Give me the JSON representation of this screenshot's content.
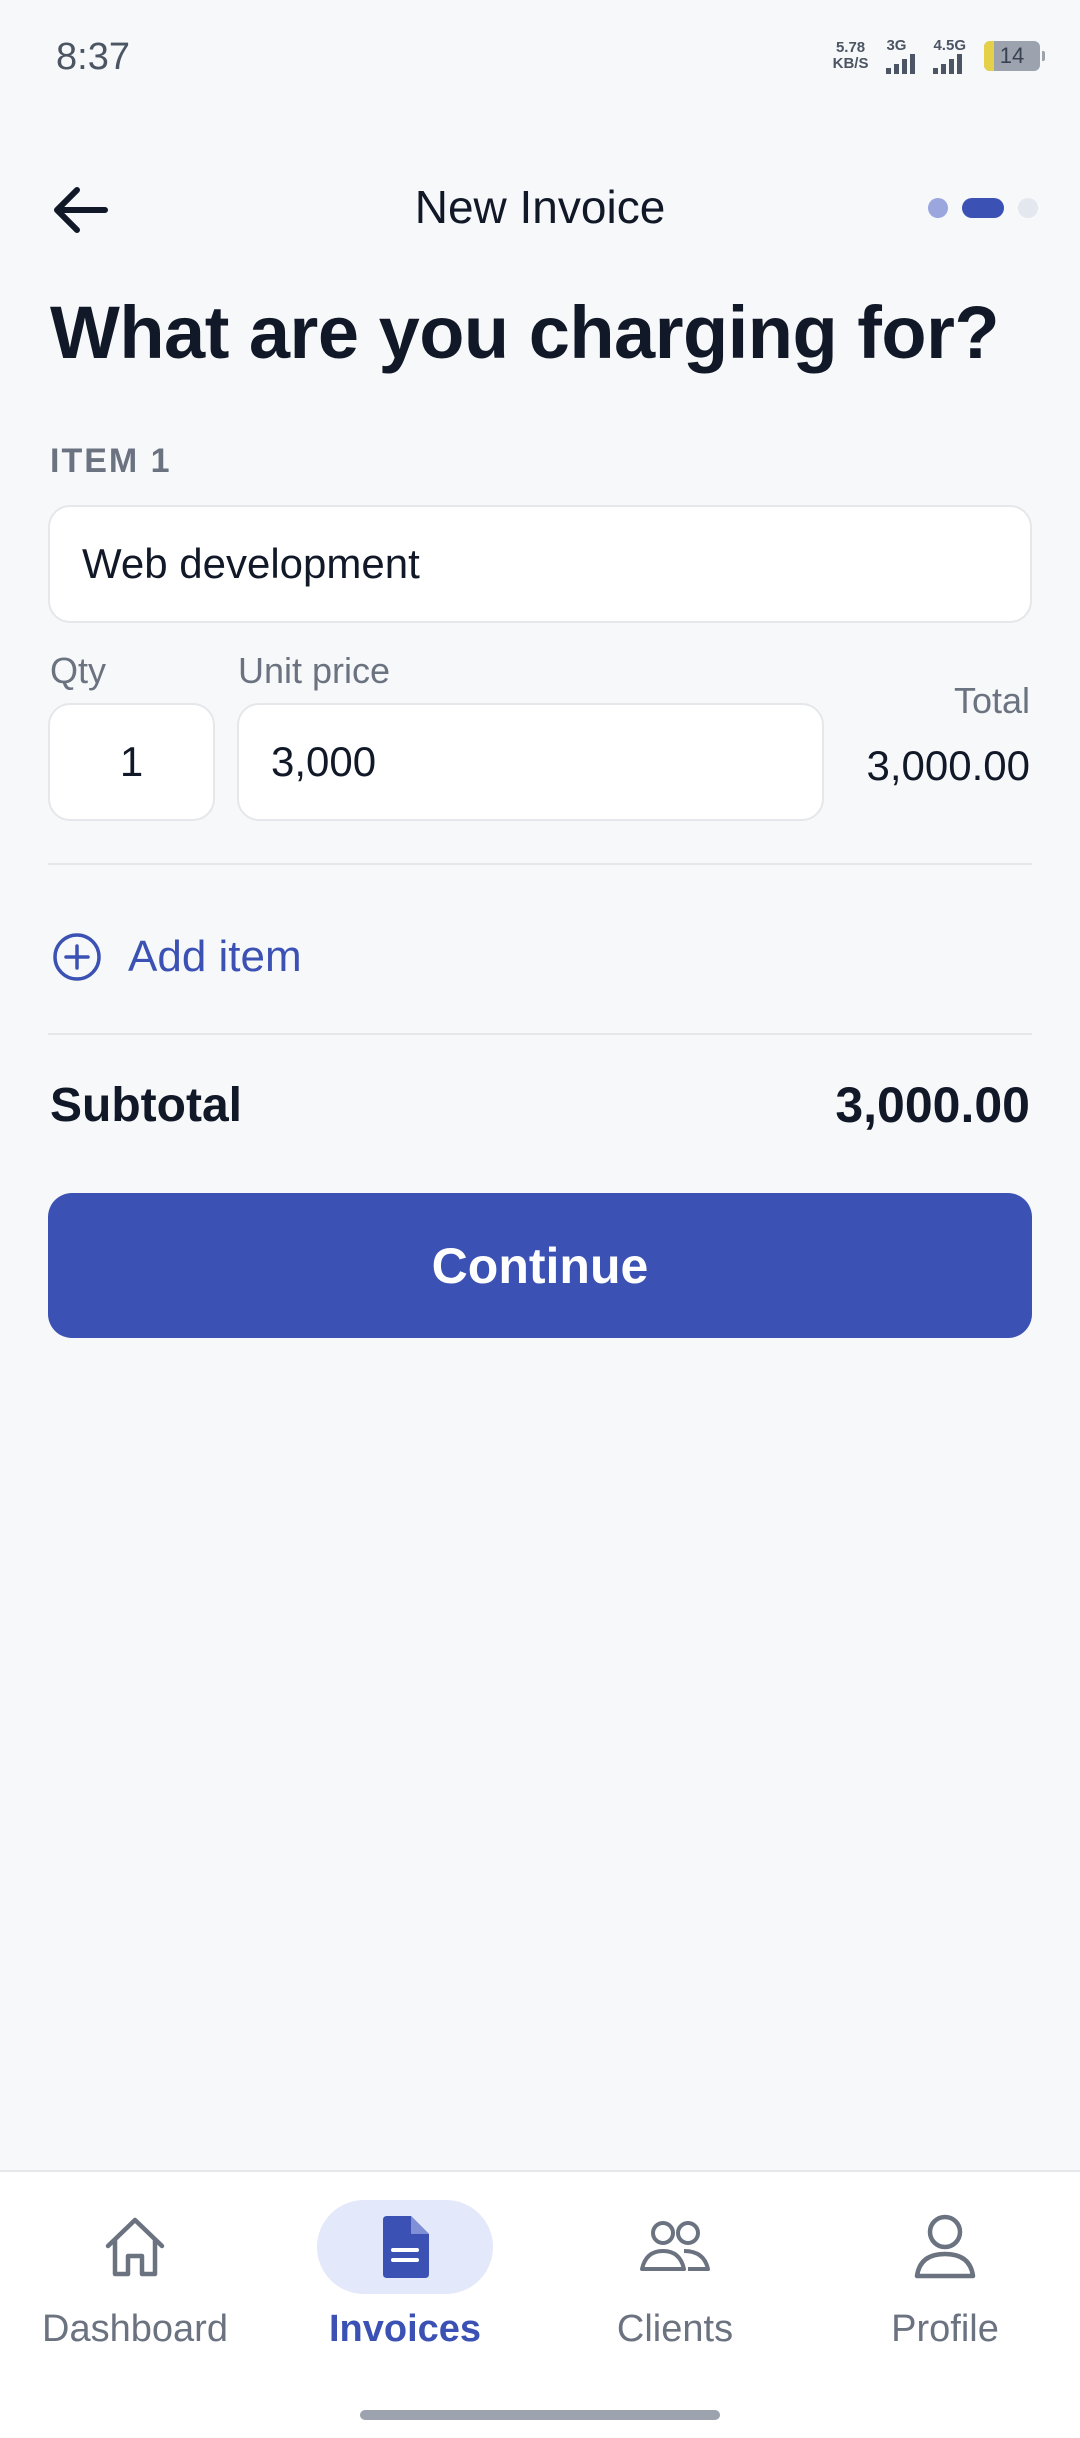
{
  "status_bar": {
    "time": "8:37",
    "net_speed_value": "5.78",
    "net_speed_unit": "KB/S",
    "sim1_label": "3G",
    "sim2_label": "4.5G",
    "battery": "14"
  },
  "header": {
    "title": "New Invoice",
    "back_icon": "arrow-left-icon",
    "steps": [
      "done",
      "active",
      "todo"
    ]
  },
  "question": "What are you charging for?",
  "item": {
    "label": "ITEM 1",
    "description": "Web development",
    "qty_label": "Qty",
    "qty": "1",
    "unit_price_label": "Unit price",
    "unit_price": "3,000",
    "total_label": "Total",
    "total": "3,000.00"
  },
  "add_item": {
    "label": "Add item",
    "icon": "plus-circle-icon"
  },
  "subtotal": {
    "label": "Subtotal",
    "value": "3,000.00"
  },
  "continue_label": "Continue",
  "colors": {
    "accent": "#3B52B4",
    "background": "#F7F8FA",
    "active_nav_bg": "#E3E8FA"
  },
  "bottom_nav": {
    "items": [
      {
        "label": "Dashboard",
        "icon": "home-icon",
        "active": false
      },
      {
        "label": "Invoices",
        "icon": "document-icon",
        "active": true
      },
      {
        "label": "Clients",
        "icon": "users-icon",
        "active": false
      },
      {
        "label": "Profile",
        "icon": "user-icon",
        "active": false
      }
    ]
  }
}
